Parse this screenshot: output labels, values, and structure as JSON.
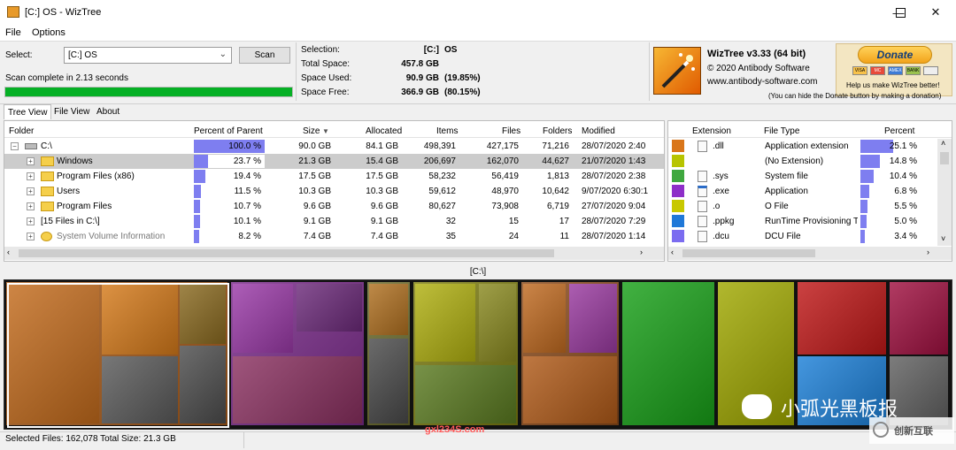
{
  "window": {
    "title": "[C:] OS - WizTree"
  },
  "menu": {
    "file": "File",
    "options": "Options"
  },
  "scan": {
    "folder_label": "Select:",
    "folder_value": "[C:] OS",
    "scan_button": "Scan",
    "status": "Scan complete in 2.13 seconds",
    "progress": 1.0
  },
  "summary": {
    "selection_label": "Selection:",
    "selection_drive": "[C:]",
    "selection_name": "OS",
    "total_label": "Total Space:",
    "total_value": "457.8 GB",
    "used_label": "Space Used:",
    "used_value": "90.9 GB",
    "used_pct": "(19.85%)",
    "free_label": "Space Free:",
    "free_value": "366.9 GB",
    "free_pct": "(80.15%)"
  },
  "about": {
    "product": "WizTree v3.33 (64 bit)",
    "copyright": "© 2020 Antibody Software",
    "website": "www.antibody-software.com"
  },
  "donate": {
    "button": "Donate",
    "cards": [
      "VISA",
      "MC",
      "AMEX",
      "BANK"
    ],
    "help": "Help us make WizTree better!",
    "hide_note": "(You can hide the Donate button by making a donation)"
  },
  "tabs": [
    "Tree View",
    "File View",
    "About"
  ],
  "tree": {
    "columns": [
      "Folder",
      "Percent of Parent",
      "Size",
      "Allocated",
      "Items",
      "Files",
      "Folders",
      "Modified"
    ],
    "rows": [
      {
        "name": "C:\\",
        "pct": "100.0 %",
        "pct_value": 100.0,
        "size": "90.0 GB",
        "allocated": "84.1 GB",
        "items": "498,391",
        "files": "427,175",
        "folders": "71,216",
        "modified": "28/07/2020 2:40",
        "level": 0,
        "expander": "−",
        "icon": "drive-icon"
      },
      {
        "name": "Windows",
        "pct": "23.7 %",
        "pct_value": 23.7,
        "size": "21.3 GB",
        "allocated": "15.4 GB",
        "items": "206,697",
        "files": "162,070",
        "folders": "44,627",
        "modified": "21/07/2020 1:43",
        "level": 1,
        "expander": "+",
        "icon": "folder-icon",
        "selected": true
      },
      {
        "name": "Program Files (x86)",
        "pct": "19.4 %",
        "pct_value": 19.4,
        "size": "17.5 GB",
        "allocated": "17.5 GB",
        "items": "58,232",
        "files": "56,419",
        "folders": "1,813",
        "modified": "28/07/2020 2:38",
        "level": 1,
        "expander": "+",
        "icon": "folder-icon"
      },
      {
        "name": "Users",
        "pct": "11.5 %",
        "pct_value": 11.5,
        "size": "10.3 GB",
        "allocated": "10.3 GB",
        "items": "59,612",
        "files": "48,970",
        "folders": "10,642",
        "modified": "9/07/2020 6:30:1",
        "level": 1,
        "expander": "+",
        "icon": "folder-icon"
      },
      {
        "name": "Program Files",
        "pct": "10.7 %",
        "pct_value": 10.7,
        "size": "9.6 GB",
        "allocated": "9.6 GB",
        "items": "80,627",
        "files": "73,908",
        "folders": "6,719",
        "modified": "27/07/2020 9:04",
        "level": 1,
        "expander": "+",
        "icon": "folder-icon"
      },
      {
        "name": "[15 Files in C:\\]",
        "pct": "10.1 %",
        "pct_value": 10.1,
        "size": "9.1 GB",
        "allocated": "9.1 GB",
        "items": "32",
        "files": "15",
        "folders": "17",
        "modified": "28/07/2020 7:29",
        "level": 1,
        "expander": "+",
        "icon": ""
      },
      {
        "name": "System Volume Information",
        "pct": "8.2 %",
        "pct_value": 8.2,
        "size": "7.4 GB",
        "allocated": "7.4 GB",
        "items": "35",
        "files": "24",
        "folders": "11",
        "modified": "28/07/2020 1:14",
        "level": 1,
        "expander": "+",
        "icon": "gear-folder-icon",
        "dim": true
      }
    ]
  },
  "filetypes": {
    "columns": [
      "Extension",
      "File Type",
      "Percent"
    ],
    "rows": [
      {
        "color": "#d9761a",
        "ext": ".dll",
        "type": "Application extension",
        "pct": "25.1 %",
        "pct_value": 25.1,
        "icon": "gear-file-icon"
      },
      {
        "color": "#b7c400",
        "ext": "",
        "type": "(No Extension)",
        "pct": "14.8 %",
        "pct_value": 14.8,
        "icon": ""
      },
      {
        "color": "#3fa83f",
        "ext": ".sys",
        "type": "System file",
        "pct": "10.4 %",
        "pct_value": 10.4,
        "icon": "gear-file-icon"
      },
      {
        "color": "#8e2fc8",
        "ext": ".exe",
        "type": "Application",
        "pct": "6.8 %",
        "pct_value": 6.8,
        "icon": "exe-icon"
      },
      {
        "color": "#c8c800",
        "ext": ".o",
        "type": "O File",
        "pct": "5.5 %",
        "pct_value": 5.5,
        "icon": "file-icon"
      },
      {
        "color": "#1f78d8",
        "ext": ".ppkg",
        "type": "RunTime Provisioning To",
        "pct": "5.0 %",
        "pct_value": 5.0,
        "icon": "file-icon"
      },
      {
        "color": "#7b6cf0",
        "ext": ".dcu",
        "type": "DCU File",
        "pct": "3.4 %",
        "pct_value": 3.4,
        "icon": "file-icon"
      }
    ]
  },
  "treemap": {
    "path": "[C:\\]"
  },
  "watermark": {
    "brand": "小弧光黑板报",
    "site": "gxl234S.com",
    "logo": "创新互联"
  },
  "status": {
    "selected_files_label": "Selected Files:",
    "selected_files": "162,078",
    "total_size_label": "Total Size:",
    "total_size": "21.3 GB"
  },
  "colors": {
    "accent": "#7e7ef0",
    "progress": "#06b025",
    "selected_row": "#cccccc"
  }
}
